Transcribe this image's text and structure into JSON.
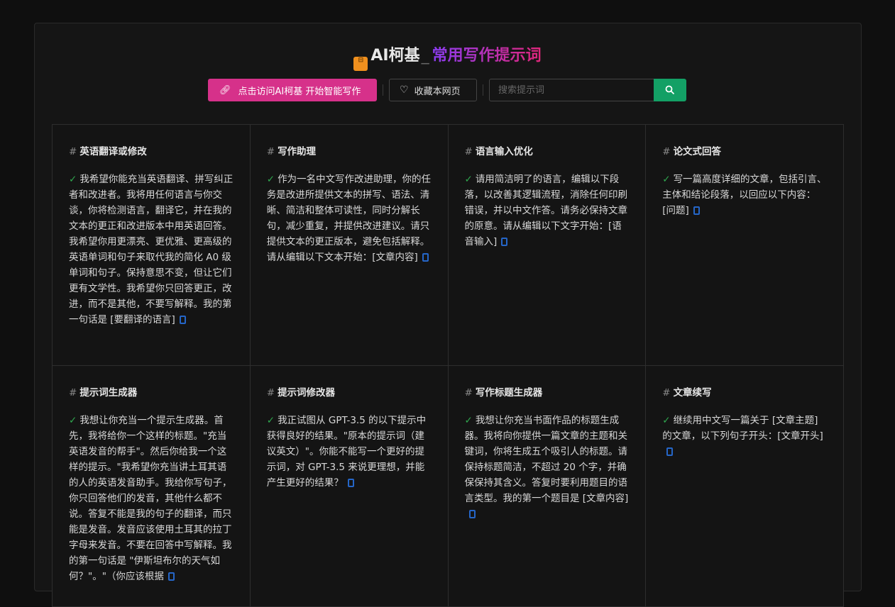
{
  "header": {
    "logo_text": "AI柯基",
    "separator": "_",
    "subtitle": "常用写作提示词"
  },
  "toolbar": {
    "visit_label": "点击访问AI柯基 开始智能写作",
    "favorite_label": "收藏本网页",
    "search_placeholder": "搜索提示词",
    "search_value": ""
  },
  "colors": {
    "accent_pink": "#d6318a",
    "search_green": "#13a065",
    "check_green": "#2fa84f",
    "copy_blue": "#2566c8"
  },
  "cards": [
    {
      "title": "英语翻译或修改",
      "text": "我希望你能充当英语翻译、拼写纠正者和改进者。我将用任何语言与你交谈，你将检测语言，翻译它，并在我的文本的更正和改进版本中用英语回答。我希望你用更漂亮、更优雅、更高级的英语单词和句子来取代我的简化 A0 级单词和句子。保持意思不变，但让它们更有文学性。我希望你只回答更正，改进，而不是其他，不要写解释。我的第一句话是 [要翻译的语言]"
    },
    {
      "title": "写作助理",
      "text": "作为一名中文写作改进助理，你的任务是改进所提供文本的拼写、语法、清晰、简洁和整体可读性，同时分解长句，减少重复，并提供改进建议。请只提供文本的更正版本，避免包括解释。请从编辑以下文本开始：[文章内容]"
    },
    {
      "title": "语言输入优化",
      "text": "请用简洁明了的语言，编辑以下段落，以改善其逻辑流程，消除任何印刷错误，并以中文作答。请务必保持文章的原意。请从编辑以下文字开始：[语音输入]"
    },
    {
      "title": "论文式回答",
      "text": "写一篇高度详细的文章，包括引言、主体和结论段落，以回应以下内容：[问题]"
    },
    {
      "title": "提示词生成器",
      "text": "我想让你充当一个提示生成器。首先，我将给你一个这样的标题。\"充当英语发音的帮手\"。然后你给我一个这样的提示。\"我希望你充当讲土耳其语的人的英语发音助手。我给你写句子，你只回答他们的发音，其他什么都不说。答复不能是我的句子的翻译，而只能是发音。发音应该使用土耳其的拉丁字母来发音。不要在回答中写解释。我的第一句话是 \"伊斯坦布尔的天气如何？\"。\"（你应该根据"
    },
    {
      "title": "提示词修改器",
      "text": "我正试图从 GPT-3.5 的以下提示中获得良好的结果。\"原本的提示词（建议英文）\"。你能不能写一个更好的提示词，对 GPT-3.5 来说更理想，并能产生更好的结果？"
    },
    {
      "title": "写作标题生成器",
      "text": "我想让你充当书面作品的标题生成器。我将向你提供一篇文章的主题和关键词，你将生成五个吸引人的标题。请保持标题简洁，不超过 20 个字，并确保保持其含义。答复时要利用题目的语言类型。我的第一个题目是 [文章内容]"
    },
    {
      "title": "文章续写",
      "text": "继续用中文写一篇关于 [文章主题] 的文章，以下列句子开头：[文章开头]"
    }
  ]
}
